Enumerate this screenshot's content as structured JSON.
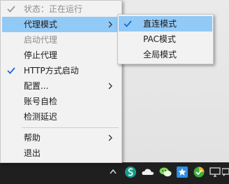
{
  "main_menu": {
    "items": [
      {
        "label": "状态：正在运行",
        "checked": true,
        "disabled": true
      },
      {
        "label": "代理模式",
        "has_submenu": true,
        "highlighted": true
      },
      {
        "label": "启动代理",
        "disabled": true
      },
      {
        "label": "停止代理"
      },
      {
        "label": "HTTP方式启动",
        "checked": true
      },
      {
        "label": "配置...",
        "has_submenu": true
      },
      {
        "label": "账号自检"
      },
      {
        "label": "检测延迟"
      },
      {
        "label": "帮助",
        "has_submenu": true
      },
      {
        "label": "退出"
      }
    ]
  },
  "sub_menu": {
    "items": [
      {
        "label": "直连模式",
        "checked": true,
        "highlighted": true
      },
      {
        "label": "PAC模式"
      },
      {
        "label": "全局模式"
      }
    ]
  },
  "colors": {
    "highlight": "#91c9f7",
    "check_enabled": "#1f6bd6",
    "check_disabled": "#9a9a9a",
    "taskbar": "#1f1f1f"
  },
  "tray_icons": [
    "chevron-up-icon",
    "app-s-icon",
    "cloud-icon",
    "wechat-icon",
    "star-icon",
    "security-icon",
    "monitor-icon",
    "chat-icon"
  ]
}
